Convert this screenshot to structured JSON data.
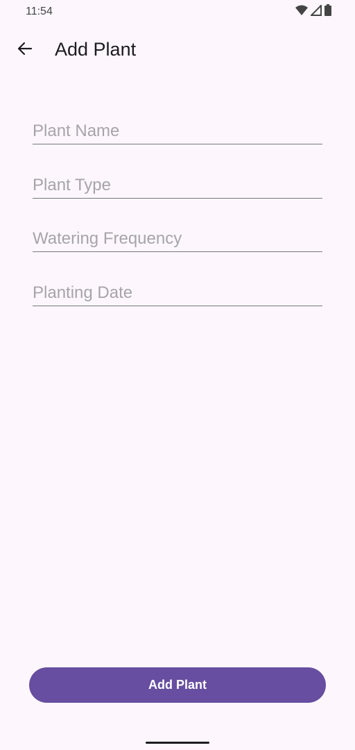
{
  "status_bar": {
    "time": "11:54",
    "icons": [
      "wifi-icon",
      "signal-icon",
      "battery-icon"
    ]
  },
  "app_bar": {
    "back_icon": "arrow-back-icon",
    "title": "Add Plant"
  },
  "form": {
    "fields": [
      {
        "placeholder": "Plant Name",
        "value": ""
      },
      {
        "placeholder": "Plant Type",
        "value": ""
      },
      {
        "placeholder": "Watering Frequency",
        "value": ""
      },
      {
        "placeholder": "Planting Date",
        "value": ""
      }
    ]
  },
  "actions": {
    "submit_label": "Add Plant"
  },
  "colors": {
    "background": "#fdf7fd",
    "primary": "#674ea0",
    "underline": "#79747e",
    "placeholder": "#a7a3ab"
  }
}
